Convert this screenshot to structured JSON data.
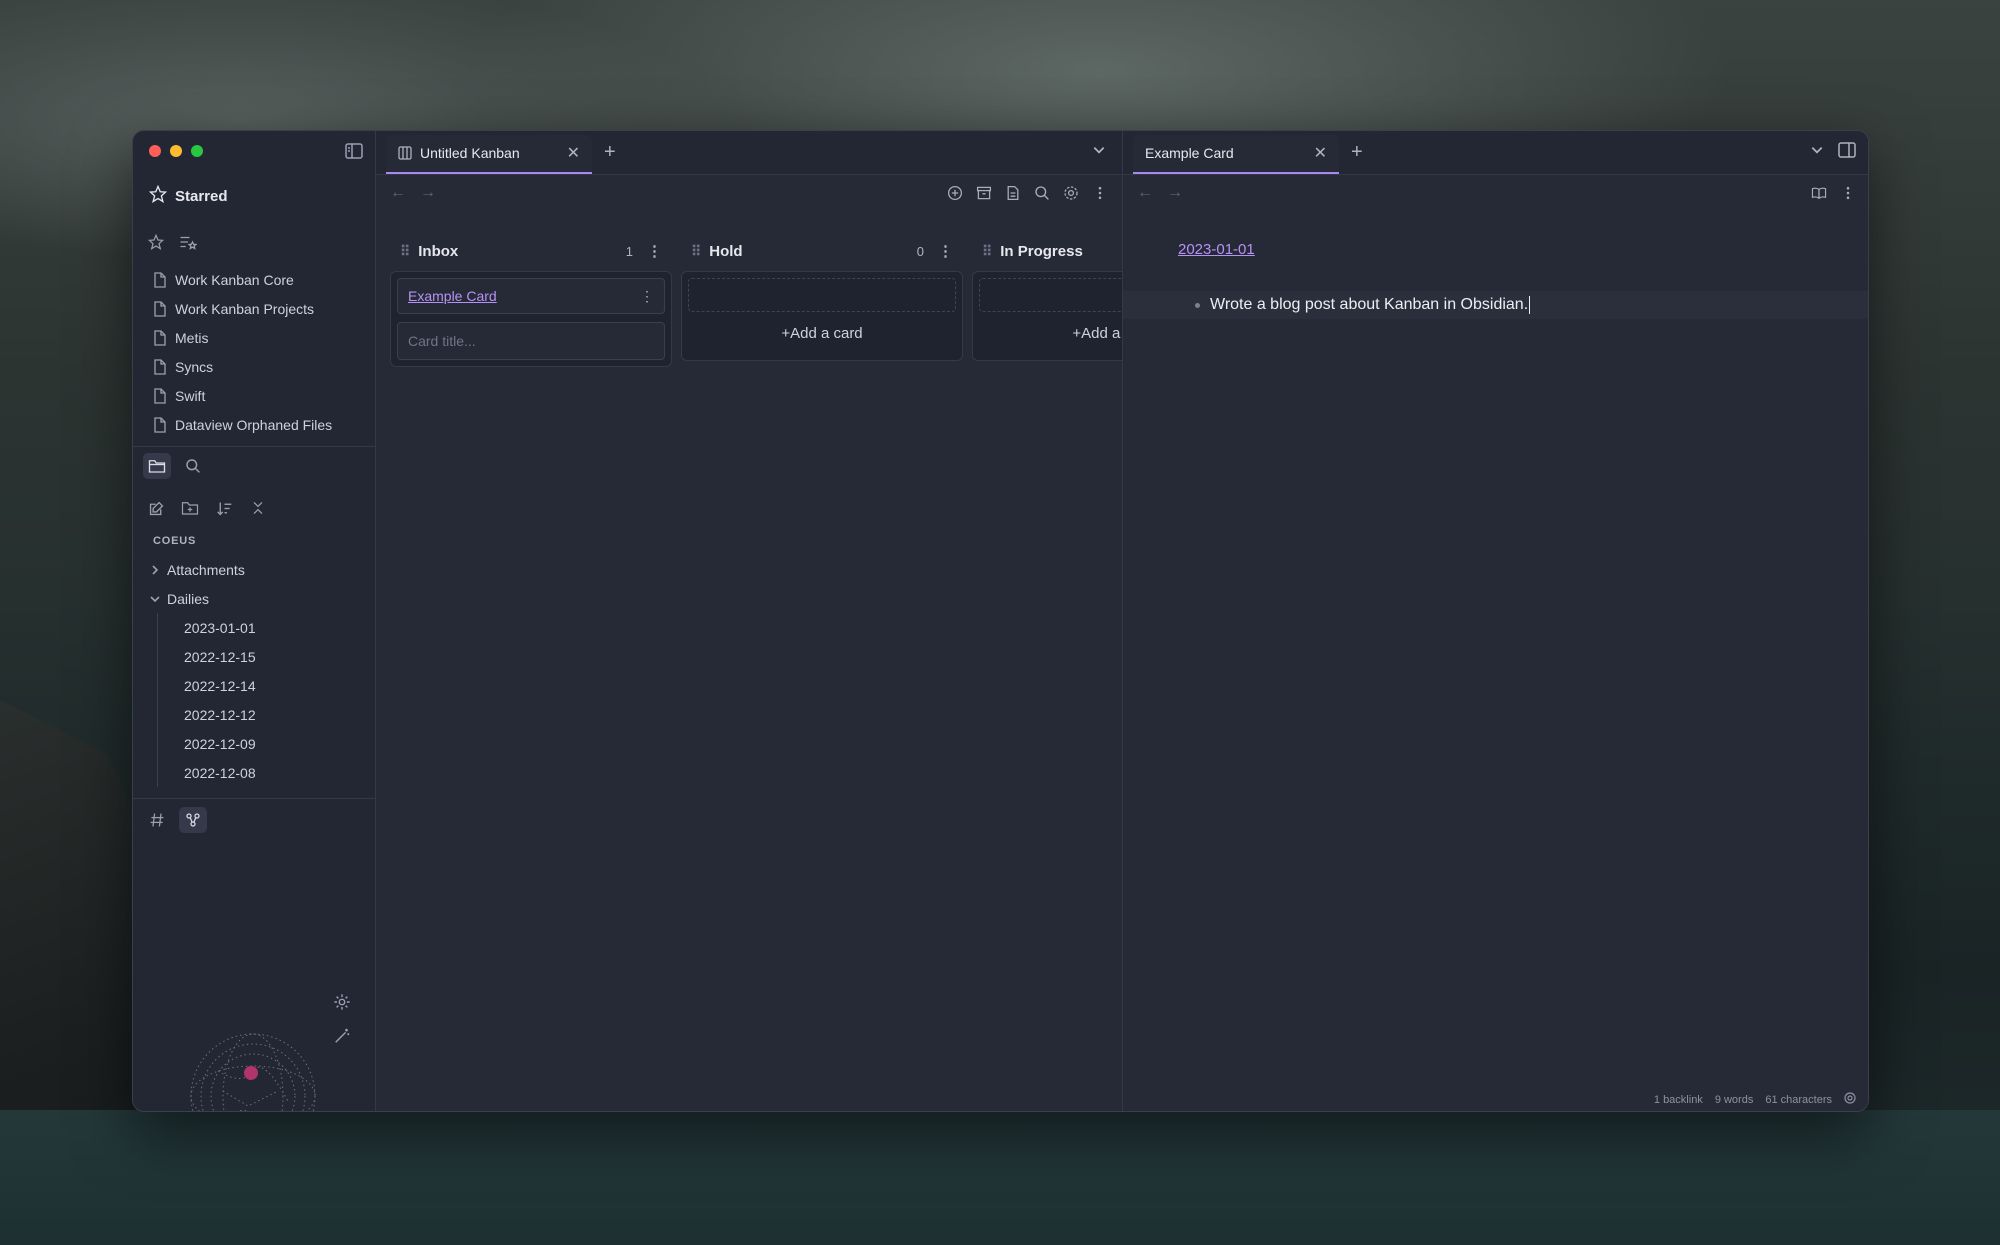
{
  "sidebar": {
    "starred_title": "Starred",
    "starred_items": [
      {
        "label": "Work Kanban Core"
      },
      {
        "label": "Work Kanban Projects"
      },
      {
        "label": "Metis"
      },
      {
        "label": "Syncs"
      },
      {
        "label": "Swift"
      },
      {
        "label": "Dataview Orphaned Files"
      }
    ],
    "vault_name": "COEUS",
    "folders": [
      {
        "label": "Attachments",
        "expanded": false
      },
      {
        "label": "Dailies",
        "expanded": true
      }
    ],
    "dailies": [
      "2023-01-01",
      "2022-12-15",
      "2022-12-14",
      "2022-12-12",
      "2022-12-09",
      "2022-12-08"
    ]
  },
  "left_pane": {
    "tab_title": "Untitled Kanban",
    "lanes": [
      {
        "title": "Inbox",
        "count": "1",
        "card": "Example Card",
        "input_placeholder": "Card title..."
      },
      {
        "title": "Hold",
        "count": "0",
        "add_label": "+Add a card"
      },
      {
        "title": "In Progress",
        "add_label": "+Add a card"
      }
    ]
  },
  "right_pane": {
    "tab_title": "Example Card",
    "link": "2023-01-01",
    "line_text": "Wrote a blog post about Kanban in Obsidian.",
    "status": {
      "backlinks": "1 backlink",
      "words": "9 words",
      "characters": "61 characters"
    }
  },
  "colors": {
    "accent": "#a989f0",
    "link": "#b692f6",
    "background": "#262a36"
  }
}
